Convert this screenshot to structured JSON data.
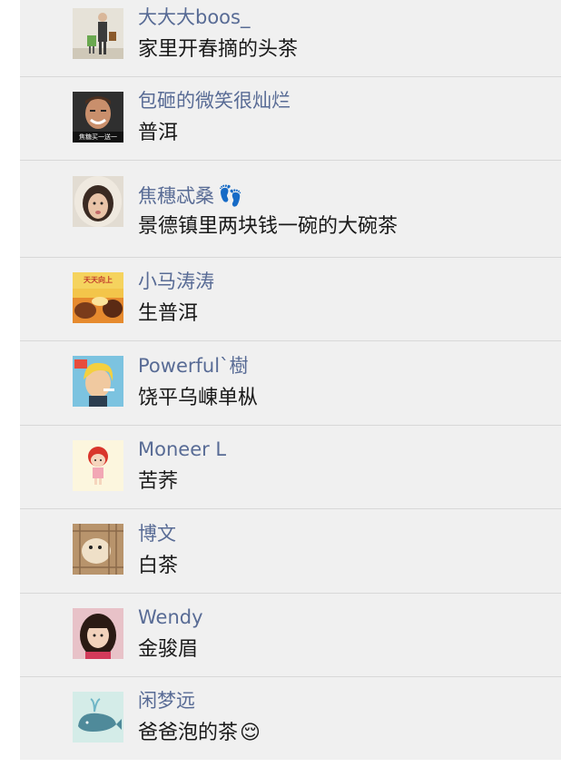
{
  "comments": [
    {
      "name": "大大大boos_",
      "text": "家里开春摘的头茶",
      "avatar_icon": "man-with-bag-avatar"
    },
    {
      "name": "包砸的微笑很灿烂",
      "text": "普洱",
      "avatar_icon": "smiling-man-meme-avatar",
      "avatar_caption": "焦糖买一送一"
    },
    {
      "name": "焦穗忒桑",
      "text": "景德镇里两块钱一碗的大碗茶",
      "avatar_icon": "girl-in-fur-hood-avatar",
      "name_emoji": "👣"
    },
    {
      "name": "小马涛涛",
      "text": "生普洱",
      "avatar_icon": "cartoon-sky-avatar",
      "avatar_caption": "天天向上"
    },
    {
      "name": "Powerful`樹",
      "text": "饶平乌崠单枞",
      "avatar_icon": "anime-blond-character-avatar"
    },
    {
      "name": "Moneer L",
      "text": "苦荞",
      "avatar_icon": "cartoon-girl-red-hair-avatar"
    },
    {
      "name": "博文",
      "text": "白茶",
      "avatar_icon": "hamster-in-cage-avatar"
    },
    {
      "name": "Wendy",
      "text": "金骏眉",
      "avatar_icon": "little-girl-photo-avatar"
    },
    {
      "name": "闲梦远",
      "text": "爸爸泡的茶",
      "avatar_icon": "cartoon-whale-avatar",
      "text_emoji": "😌"
    }
  ]
}
